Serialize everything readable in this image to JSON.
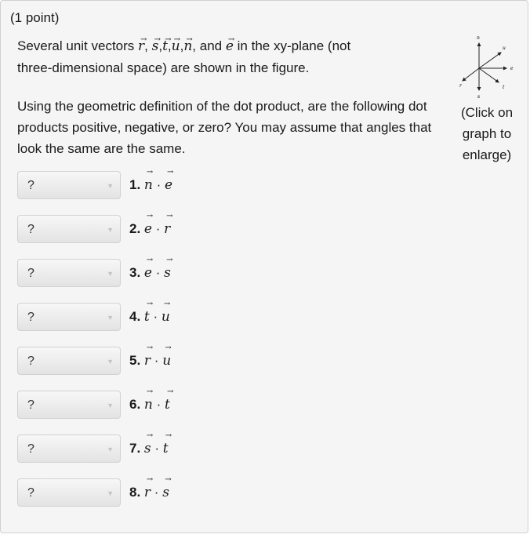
{
  "points": "(1 point)",
  "intro": {
    "prefix": "Several unit vectors ",
    "vectors": [
      "r",
      "s",
      "t",
      "u",
      "n"
    ],
    "and": "and",
    "last": "e",
    "suffix_line1": " in the xy-plane (not",
    "line2": "three-dimensional space) are shown in the figure."
  },
  "instructions": "Using the geometric definition of the dot product, are the following dot products positive, negative, or zero? You may assume that angles that look the same are the same.",
  "figure_labels": {
    "n": "n",
    "u": "u",
    "e": "e",
    "t": "t",
    "s": "s",
    "r": "r"
  },
  "enlarge_text": "(Click on graph to enlarge)",
  "questions": [
    {
      "num": "1.",
      "a": "n",
      "b": "e",
      "answer": "?"
    },
    {
      "num": "2.",
      "a": "e",
      "b": "r",
      "answer": "?"
    },
    {
      "num": "3.",
      "a": "e",
      "b": "s",
      "answer": "?"
    },
    {
      "num": "4.",
      "a": "t",
      "b": "u",
      "answer": "?"
    },
    {
      "num": "5.",
      "a": "r",
      "b": "u",
      "answer": "?"
    },
    {
      "num": "6.",
      "a": "n",
      "b": "t",
      "answer": "?"
    },
    {
      "num": "7.",
      "a": "s",
      "b": "t",
      "answer": "?"
    },
    {
      "num": "8.",
      "a": "r",
      "b": "s",
      "answer": "?"
    }
  ]
}
